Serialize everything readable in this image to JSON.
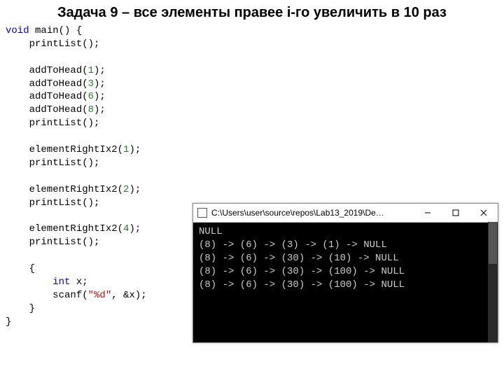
{
  "title": "Задача 9 – все элементы правее i-го увеличить в 10 раз",
  "code": {
    "l1_kw": "void",
    "l1_rest": " main() {",
    "l2": "    printList();",
    "l3": "",
    "l4a": "    addToHead(",
    "l4n": "1",
    "l4b": ");",
    "l5a": "    addToHead(",
    "l5n": "3",
    "l5b": ");",
    "l6a": "    addToHead(",
    "l6n": "6",
    "l6b": ");",
    "l7a": "    addToHead(",
    "l7n": "8",
    "l7b": ");",
    "l8": "    printList();",
    "l9": "",
    "l10a": "    elementRightIx2(",
    "l10n": "1",
    "l10b": ");",
    "l11": "    printList();",
    "l12": "",
    "l13a": "    elementRightIx2(",
    "l13n": "2",
    "l13b": ");",
    "l14": "    printList();",
    "l15": "",
    "l16a": "    elementRightIx2(",
    "l16n": "4",
    "l16b": ");",
    "l17": "    printList();",
    "l18": "",
    "l19": "    {",
    "l20_kw": "        int",
    "l20_rest": " x;",
    "l21a": "        scanf(",
    "l21s": "\"%d\"",
    "l21b": ", &x);",
    "l22": "    }",
    "l23": "}"
  },
  "console": {
    "title": "C:\\Users\\user\\source\\repos\\Lab13_2019\\De…",
    "lines": [
      "NULL",
      "(8) -> (6) -> (3) -> (1) -> NULL",
      "(8) -> (6) -> (30) -> (10) -> NULL",
      "(8) -> (6) -> (30) -> (100) -> NULL",
      "(8) -> (6) -> (30) -> (100) -> NULL"
    ]
  }
}
